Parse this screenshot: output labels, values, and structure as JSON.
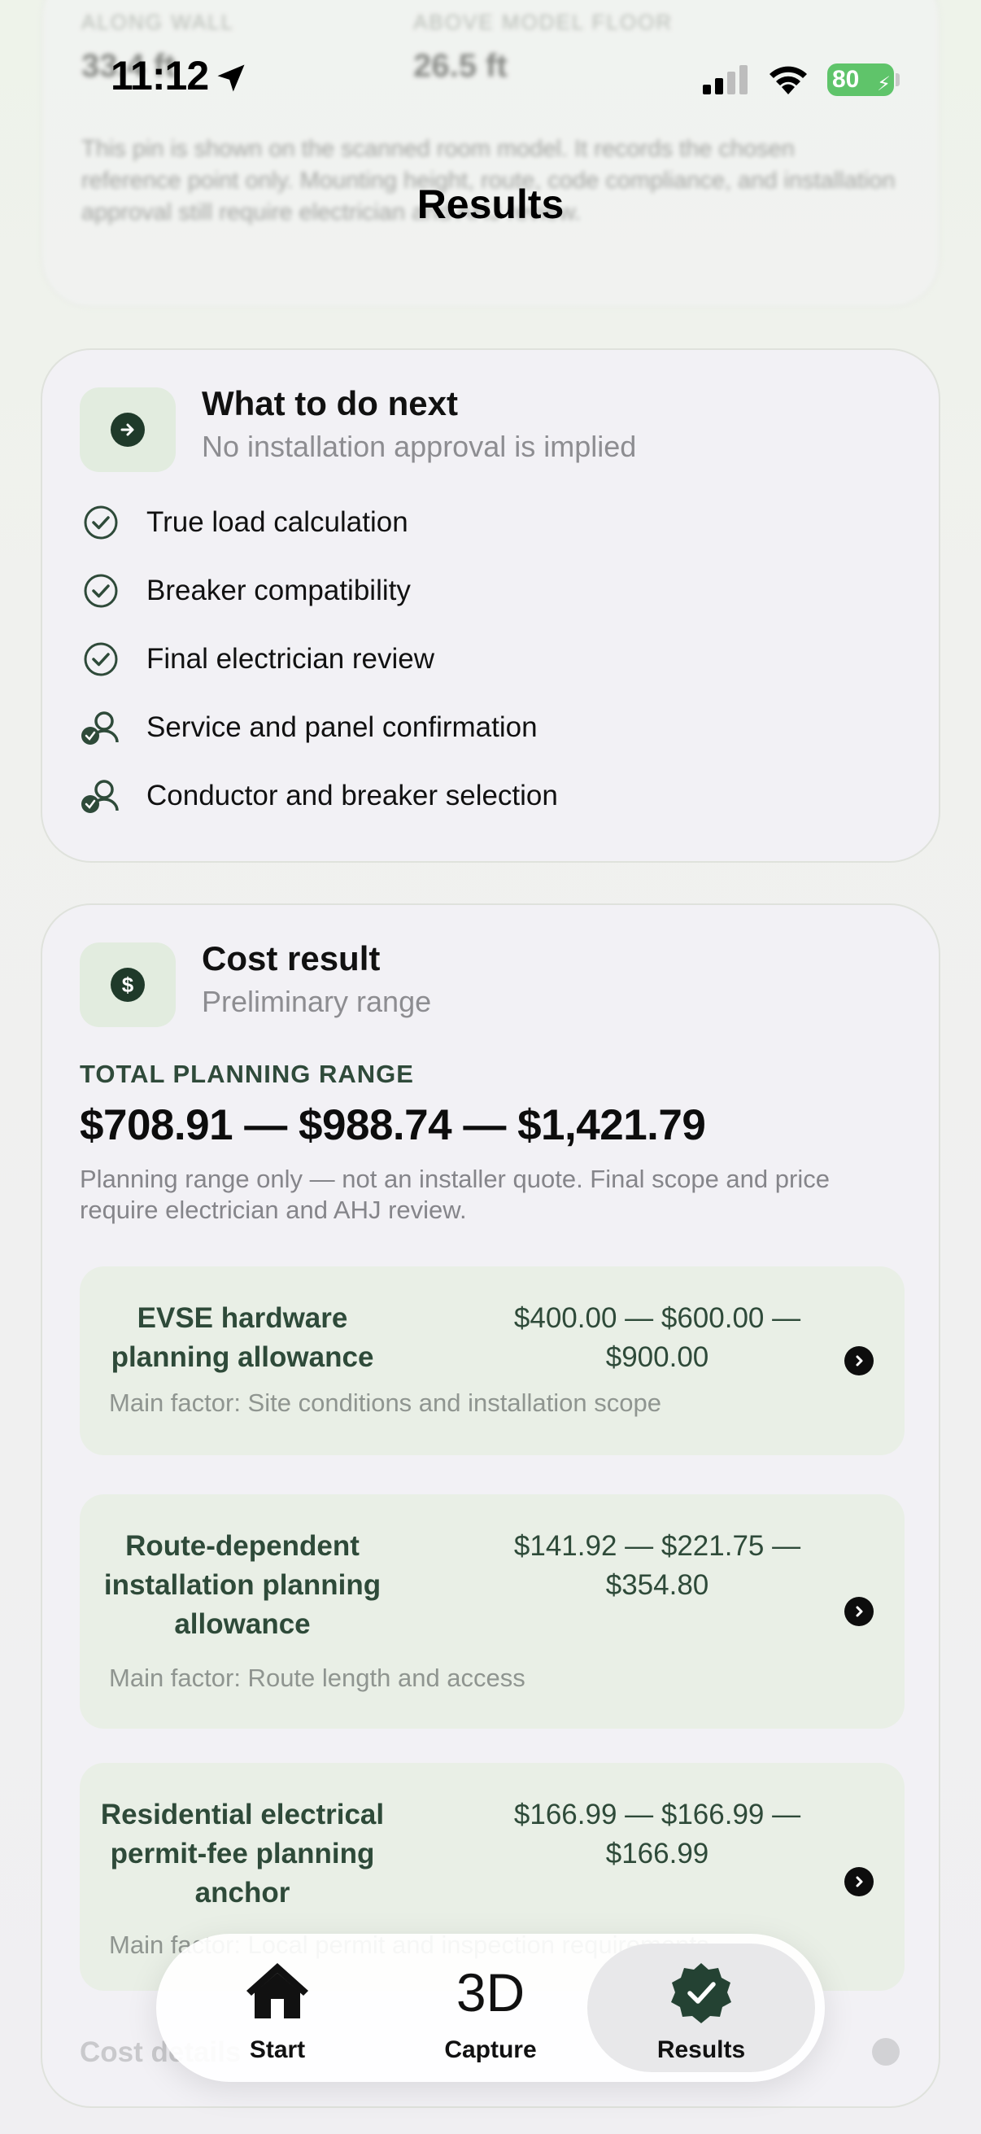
{
  "status_bar": {
    "time": "11:12",
    "battery": "80"
  },
  "nav": {
    "title": "Results"
  },
  "faded_card": {
    "stat1_label": "ALONG WALL",
    "stat1_value": "33.4 ft",
    "stat2_label": "ABOVE MODEL FLOOR",
    "stat2_value": "26.5 ft",
    "note": "This pin is shown on the scanned room model. It records the chosen reference point only. Mounting height, route, code compliance, and installation approval still require electrician and AHJ review."
  },
  "next_card": {
    "title": "What to do next",
    "subtitle": "No installation approval is implied",
    "items": [
      {
        "label": "True load calculation",
        "icon": "check-circle-icon"
      },
      {
        "label": "Breaker compatibility",
        "icon": "check-circle-icon"
      },
      {
        "label": "Final electrician review",
        "icon": "check-circle-icon"
      },
      {
        "label": "Service and panel confirmation",
        "icon": "person-check-icon"
      },
      {
        "label": "Conductor and breaker selection",
        "icon": "person-check-icon"
      }
    ]
  },
  "cost_card": {
    "title": "Cost result",
    "subtitle": "Preliminary range",
    "icon_glyph": "$",
    "range_label": "TOTAL PLANNING RANGE",
    "range_value": "$708.91 — $988.74 — $1,421.79",
    "range_note": "Planning range only — not an installer quote. Final scope and price require electrician and AHJ review.",
    "line_items": [
      {
        "title": "EVSE hardware planning allowance",
        "price": "$400.00 — $600.00 — $900.00",
        "factor": "Main factor: Site conditions and installation scope"
      },
      {
        "title": "Route-dependent installation planning allowance",
        "price": "$141.92 — $221.75 — $354.80",
        "factor": "Main factor: Route length and access"
      },
      {
        "title": "Residential electrical permit-fee planning anchor",
        "price": "$166.99 — $166.99 — $166.99",
        "factor": "Main factor: Local permit and inspection requirements"
      }
    ],
    "details_label": "Cost details"
  },
  "tabbar": {
    "tabs": [
      {
        "label": "Start",
        "icon": "house-icon"
      },
      {
        "label": "Capture",
        "glyph": "3D"
      },
      {
        "label": "Results",
        "icon": "badge-check-icon"
      }
    ]
  },
  "colors": {
    "accent_dark": "#1f3a2a",
    "accent_light": "#e2ecdf",
    "battery": "#5fc46a"
  }
}
